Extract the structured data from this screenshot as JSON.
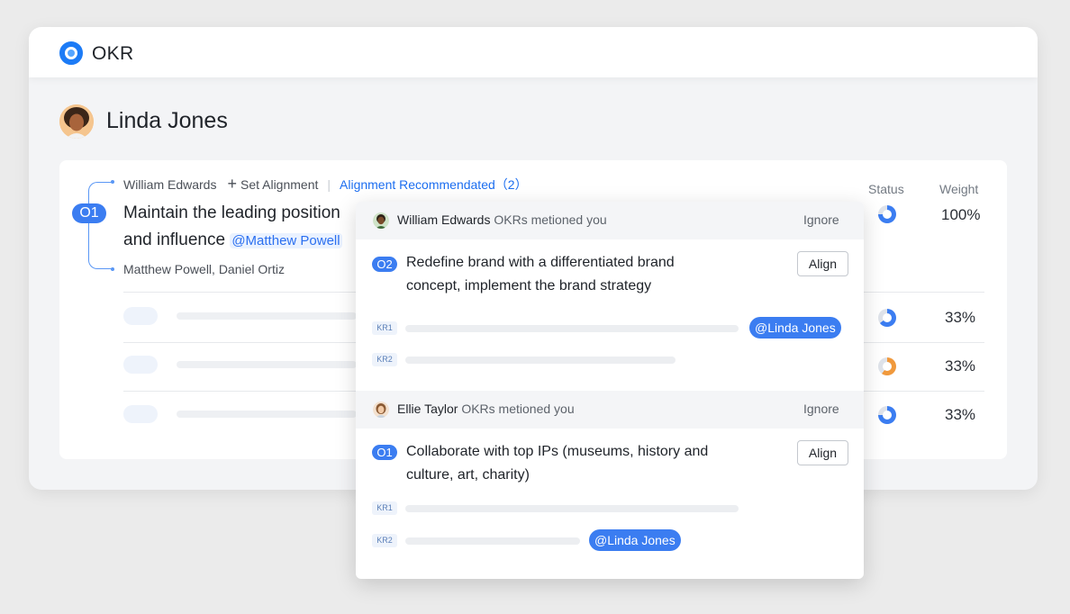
{
  "app": {
    "title": "OKR"
  },
  "user": {
    "name": "Linda Jones"
  },
  "objective": {
    "badge": "O1",
    "text": "Maintain the leading position and influence",
    "text_line1": "Maintain the leading position",
    "text_line2": "and influence",
    "mention": "@Matthew Powell",
    "aligned_from": "William Edwards",
    "set_alignment_label": "Set Alignment",
    "recommended_label": "Alignment Recommendated",
    "recommended_count": "（2）",
    "aligned_to": "Matthew Powell, Daniel Ortiz"
  },
  "table": {
    "status_header": "Status",
    "weight_header": "Weight",
    "rows": [
      {
        "weight": "100%",
        "status_color": "#3b7df1",
        "status_progress": 0.75
      },
      {
        "weight": "33%",
        "status_color": "#3b7df1",
        "status_progress": 0.65
      },
      {
        "weight": "33%",
        "status_color": "#f0993c",
        "status_progress": 0.6
      },
      {
        "weight": "33%",
        "status_color": "#3b7df1",
        "status_progress": 0.75
      }
    ]
  },
  "popup": {
    "groups": [
      {
        "author": "William Edwards",
        "suffix": "OKRs metioned you",
        "ignore_label": "Ignore",
        "objective_badge": "O2",
        "objective_line1": "Redefine brand with a differentiated brand",
        "objective_line2": "concept, implement the brand strategy",
        "align_label": "Align",
        "kr1_label": "KR1",
        "kr2_label": "KR2",
        "mention": "@Linda Jones"
      },
      {
        "author": "Ellie Taylor",
        "suffix": "OKRs metioned you",
        "ignore_label": "Ignore",
        "objective_badge": "O1",
        "objective_line1": "Collaborate with top IPs (museums, history and",
        "objective_line2": "culture, art, charity)",
        "align_label": "Align",
        "kr1_label": "KR1",
        "kr2_label": "KR2",
        "mention": "@Linda Jones"
      }
    ]
  },
  "colors": {
    "accent": "#3b7df1",
    "warning": "#f0993c",
    "logo": "#1c7bf6"
  }
}
